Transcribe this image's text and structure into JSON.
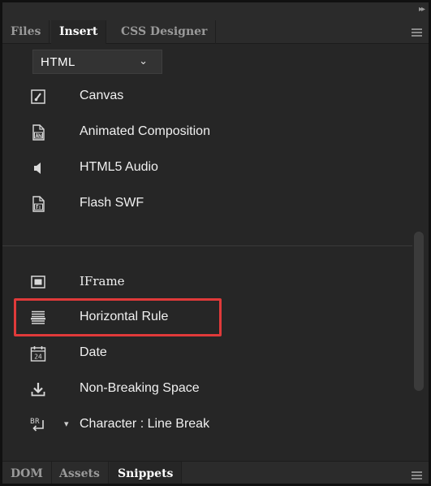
{
  "panel_tabs": [
    "Files",
    "Insert",
    "CSS Designer"
  ],
  "category_dropdown": {
    "value": "HTML"
  },
  "items": [
    {
      "label": "Canvas",
      "icon": "canvas-icon"
    },
    {
      "label": "Animated Composition",
      "icon": "animated-composition-icon"
    },
    {
      "label": "HTML5 Audio",
      "icon": "speaker-icon"
    },
    {
      "label": "Flash SWF",
      "icon": "flash-file-icon"
    },
    {
      "label": "IFrame",
      "icon": "iframe-icon"
    },
    {
      "label": "Horizontal Rule",
      "icon": "horizontal-rule-icon"
    },
    {
      "label": "Date",
      "icon": "calendar-icon",
      "icon_text": "24"
    },
    {
      "label": "Non-Breaking Space",
      "icon": "download-arrow-icon"
    },
    {
      "label": "Character : Line Break",
      "icon": "line-break-icon",
      "icon_text": "BR"
    }
  ],
  "highlighted_item": "Horizontal Rule",
  "bottom_tabs": [
    "DOM",
    "Assets",
    "Snippets"
  ],
  "colors": {
    "panel_bg": "#262626",
    "highlight": "#e03a3a",
    "text": "#f0f0f0"
  }
}
